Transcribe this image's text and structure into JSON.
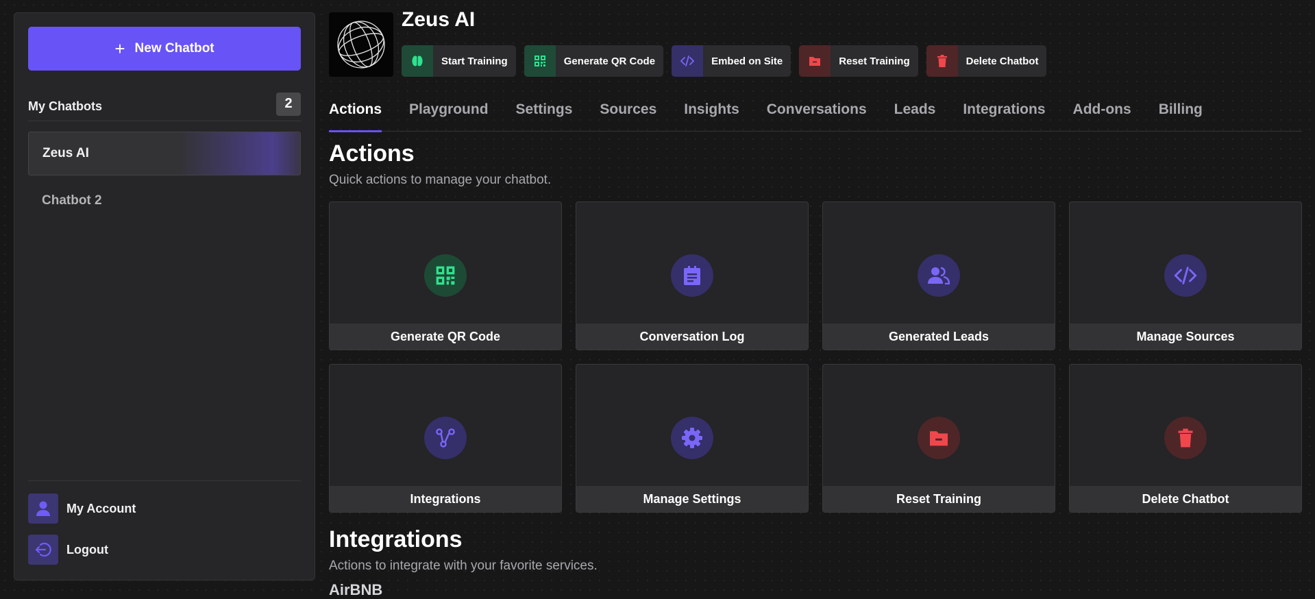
{
  "sidebar": {
    "new_button": "New Chatbot",
    "my_chatbots_label": "My Chatbots",
    "chatbot_count": "2",
    "chatbots": [
      {
        "label": "Zeus AI",
        "active": true
      },
      {
        "label": "Chatbot 2",
        "active": false
      }
    ],
    "account_label": "My Account",
    "logout_label": "Logout"
  },
  "header": {
    "bot_name": "Zeus AI",
    "actions": [
      {
        "label": "Start Training",
        "icon": "brain-icon"
      },
      {
        "label": "Generate QR Code",
        "icon": "qr-code-icon"
      },
      {
        "label": "Embed on Site",
        "icon": "code-icon"
      },
      {
        "label": "Reset Training",
        "icon": "folder-minus-icon"
      },
      {
        "label": "Delete Chatbot",
        "icon": "trash-icon"
      }
    ]
  },
  "tabs": [
    "Actions",
    "Playground",
    "Settings",
    "Sources",
    "Insights",
    "Conversations",
    "Leads",
    "Integrations",
    "Add-ons",
    "Billing"
  ],
  "actions_section": {
    "title": "Actions",
    "subtitle": "Quick actions to manage your chatbot.",
    "cards": [
      {
        "label": "Generate QR Code",
        "icon": "qr-code-icon"
      },
      {
        "label": "Conversation Log",
        "icon": "clipboard-icon"
      },
      {
        "label": "Generated Leads",
        "icon": "users-icon"
      },
      {
        "label": "Manage Sources",
        "icon": "code-icon"
      },
      {
        "label": "Integrations",
        "icon": "share-nodes-icon"
      },
      {
        "label": "Manage Settings",
        "icon": "gear-icon"
      },
      {
        "label": "Reset Training",
        "icon": "folder-minus-icon"
      },
      {
        "label": "Delete Chatbot",
        "icon": "trash-icon"
      }
    ]
  },
  "integrations_section": {
    "title": "Integrations",
    "subtitle": "Actions to integrate with your favorite services.",
    "first_item": "AirBNB"
  },
  "colors": {
    "accent": "#6853f6",
    "green": "#2ee28e",
    "red": "#f0474d",
    "purple": "#6f5cf6"
  }
}
